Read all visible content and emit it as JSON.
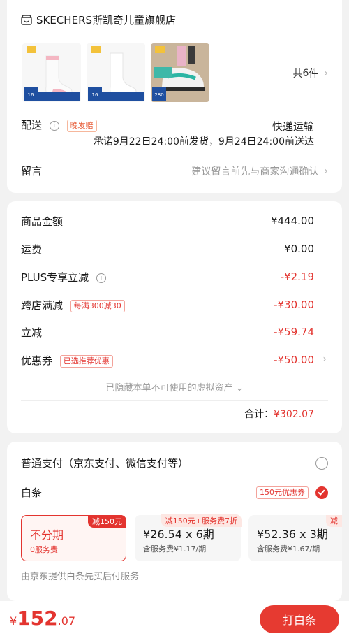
{
  "shop": {
    "name": "SKECHERS斯凯奇儿童旗舰店",
    "icon": "shop-icon"
  },
  "items": [
    {
      "thumb_alt": "白色粉边袜子",
      "badge": "16"
    },
    {
      "thumb_alt": "白色袜子",
      "badge": "16"
    },
    {
      "thumb_alt": "彩色运动鞋",
      "badge": "280"
    }
  ],
  "count": {
    "prefix": "共",
    "num": "6",
    "suffix": "件"
  },
  "delivery": {
    "label": "配送",
    "tag": "晚发赔",
    "method": "快递运输",
    "promise": "承诺9月22日24:00前发货，9月24日24:00前送达"
  },
  "message": {
    "label": "留言",
    "placeholder": "建议留言前先与商家沟通确认"
  },
  "summary": {
    "goods_label": "商品金额",
    "goods_value": "¥444.00",
    "shipping_label": "运费",
    "shipping_value": "¥0.00",
    "plus_label": "PLUS专享立减",
    "plus_value": "-¥2.19",
    "cross_label": "跨店满减",
    "cross_tag": "每满300减30",
    "cross_value": "-¥30.00",
    "instant_label": "立减",
    "instant_value": "-¥59.74",
    "coupon_label": "优惠券",
    "coupon_tag": "已选推荐优惠",
    "coupon_value": "-¥50.00",
    "hidden_note": "已隐藏本单不可使用的虚拟资产",
    "total_label": "合计：",
    "total_value": "¥302.07"
  },
  "payment": {
    "normal_label": "普通支付（京东支付、微信支付等）",
    "baitiao_label": "白条",
    "baitiao_tag": "150元优惠券",
    "plans": [
      {
        "badge": "减150元",
        "main": "不分期",
        "sub": "0服务费"
      },
      {
        "badge": "减150元+服务费7折",
        "main": "¥26.54 x 6期",
        "sub": "含服务费¥1.17/期"
      },
      {
        "badge": "减",
        "main": "¥52.36 x 3期",
        "sub": "含服务费¥1.67/期"
      }
    ],
    "provider_note": "由京东提供白条先买后付服务"
  },
  "footer": {
    "currency": "¥",
    "amount_int": "152",
    "amount_dec": ".07",
    "button": "打白条"
  },
  "colors": {
    "accent": "#e3342f",
    "bg": "#f2f2f2"
  }
}
